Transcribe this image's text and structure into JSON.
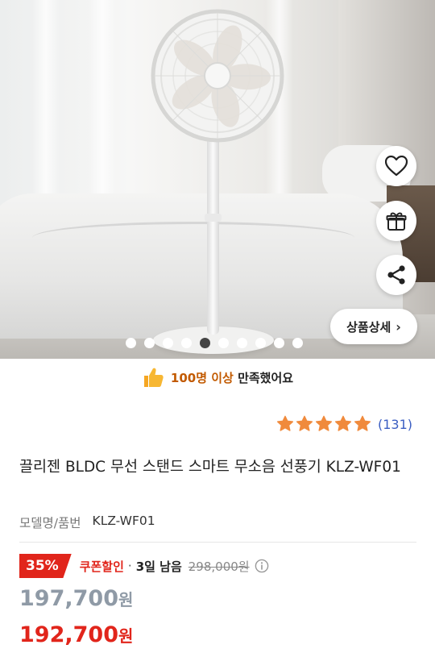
{
  "gallery": {
    "dots_total": 10,
    "active_index": 4,
    "detail_button_label": "상품상세"
  },
  "actions": {
    "wishlist_icon": "heart-icon",
    "gift_icon": "gift-icon",
    "share_icon": "share-icon"
  },
  "satisfaction": {
    "highlight": "100명 이상",
    "rest": "만족했어요",
    "icon": "thumbs-up-icon"
  },
  "rating": {
    "stars": 5,
    "review_count": "(131)"
  },
  "product": {
    "title": "끌리젠 BLDC 무선 스탠드 스마트 무소음 선풍기 KLZ-WF01",
    "model_label": "모델명/품번",
    "model_value": "KLZ-WF01"
  },
  "price": {
    "discount_pct": "35%",
    "coupon_label": "쿠폰할인",
    "separator": "·",
    "remaining": "3일 남음",
    "original": "298,000원",
    "price_main": "197,700",
    "price_coupon": "192,700",
    "currency": "원"
  },
  "colors": {
    "accent_red": "#e1251b",
    "review_blue": "#3b5ec2",
    "star_orange": "#f08a3c",
    "satisfaction_orange": "#c25a00"
  }
}
